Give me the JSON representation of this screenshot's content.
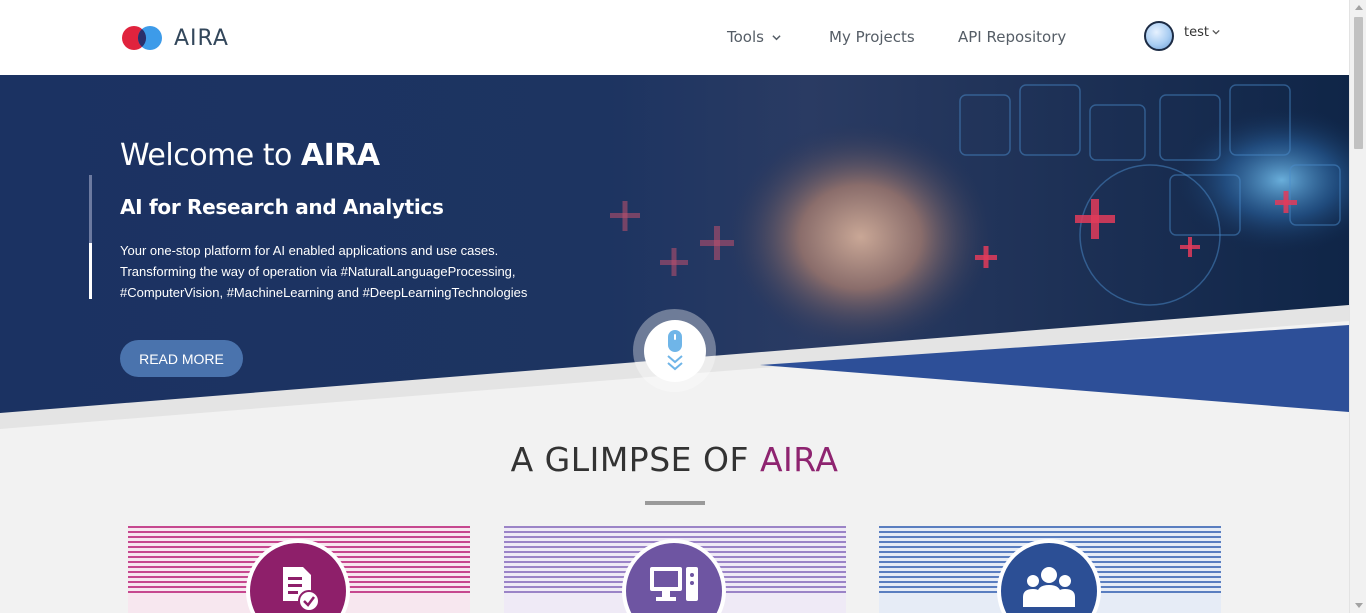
{
  "header": {
    "logo_text": "AIRA",
    "nav": {
      "tools": "Tools",
      "my_projects": "My Projects",
      "api_repository": "API Repository"
    },
    "user": {
      "name": "test"
    }
  },
  "hero": {
    "title_prefix": "Welcome to ",
    "title_brand": "AIRA",
    "subtitle": "AI for Research and Analytics",
    "description": "Your one-stop platform for AI enabled applications and use cases. Transforming the way of operation via #NaturalLanguageProcessing, #ComputerVision, #MachineLearning and #DeepLearningTechnologies",
    "read_more": "READ MORE"
  },
  "glimpse": {
    "title_prefix": "A GLIMPSE OF ",
    "title_brand": "AIRA",
    "cards": [
      {
        "icon": "document-check-icon",
        "color": "#8e1f6a"
      },
      {
        "icon": "computer-icon",
        "color": "#6e55a2"
      },
      {
        "icon": "users-icon",
        "color": "#2c4f95"
      }
    ]
  },
  "colors": {
    "brand_purple": "#8e2470",
    "hero_navy": "#1d3461",
    "button_blue": "#4a73ad"
  }
}
